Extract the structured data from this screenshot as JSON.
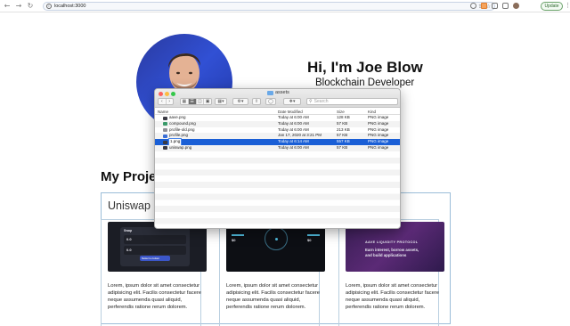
{
  "browser": {
    "url": "localhost:3000",
    "update_label": "Update",
    "back_icon": "arrow-left-icon",
    "forward_icon": "arrow-right-icon",
    "reload_icon": "reload-icon"
  },
  "hero": {
    "name": "Hi, I'm Joe Blow",
    "role": "Blockchain Developer"
  },
  "projects": {
    "section_title": "My Projects",
    "featured_title": "Uniswap",
    "cards": [
      {
        "thumb_labels": [
          "Swap",
          "0.0",
          "0.0",
          "Select a token"
        ],
        "description": "Lorem, ipsum dolor sit amet consectetur adipisicing elit. Facilis consectetur facere neque assumenda quasi aliquid, perferendis ratione rerum dolorem."
      },
      {
        "thumb_labels": [
          "$0",
          "$0"
        ],
        "description": "Lorem, ipsum dolor sit amet consectetur adipisicing elit. Facilis consectetur facere neque assumenda quasi aliquid, perferendis ratione rerum dolorem."
      },
      {
        "thumb_labels": [
          "AAVE LIQUIDITY PROTOCOL",
          "Earn interest, borrow assets, and build applications"
        ],
        "description": "Lorem, ipsum dolor sit amet consectetur adipisicing elit. Facilis consectetur facere neque assumenda quasi aliquid, perferendis ratione rerum dolorem."
      }
    ]
  },
  "finder": {
    "title": "assets",
    "search_placeholder": "Search",
    "columns": {
      "name": "Name",
      "date": "Date Modified",
      "size": "Size",
      "kind": "Kind"
    },
    "files": [
      {
        "name": "aave.png",
        "date": "Today at 6:00 AM",
        "size": "128 KB",
        "kind": "PNG image",
        "icon": "image-file-icon",
        "selected": false
      },
      {
        "name": "compound.png",
        "date": "Today at 6:00 AM",
        "size": "57 KB",
        "kind": "PNG image",
        "icon": "image-file-icon",
        "selected": false
      },
      {
        "name": "profile-old.png",
        "date": "Today at 6:00 AM",
        "size": "213 KB",
        "kind": "PNG image",
        "icon": "image-file-icon",
        "selected": false
      },
      {
        "name": "profile.png",
        "date": "Jan 17, 2020 at 3:21 PM",
        "size": "57 KB",
        "kind": "PNG image",
        "icon": "image-file-icon",
        "selected": false
      },
      {
        "name": "1.png",
        "date": "Today at 6:14 AM",
        "size": "557 KB",
        "kind": "PNG image",
        "icon": "image-file-icon",
        "selected": true
      },
      {
        "name": "uniswap.png",
        "date": "Today at 6:00 AM",
        "size": "57 KB",
        "kind": "PNG image",
        "icon": "image-file-icon",
        "selected": false
      }
    ]
  }
}
